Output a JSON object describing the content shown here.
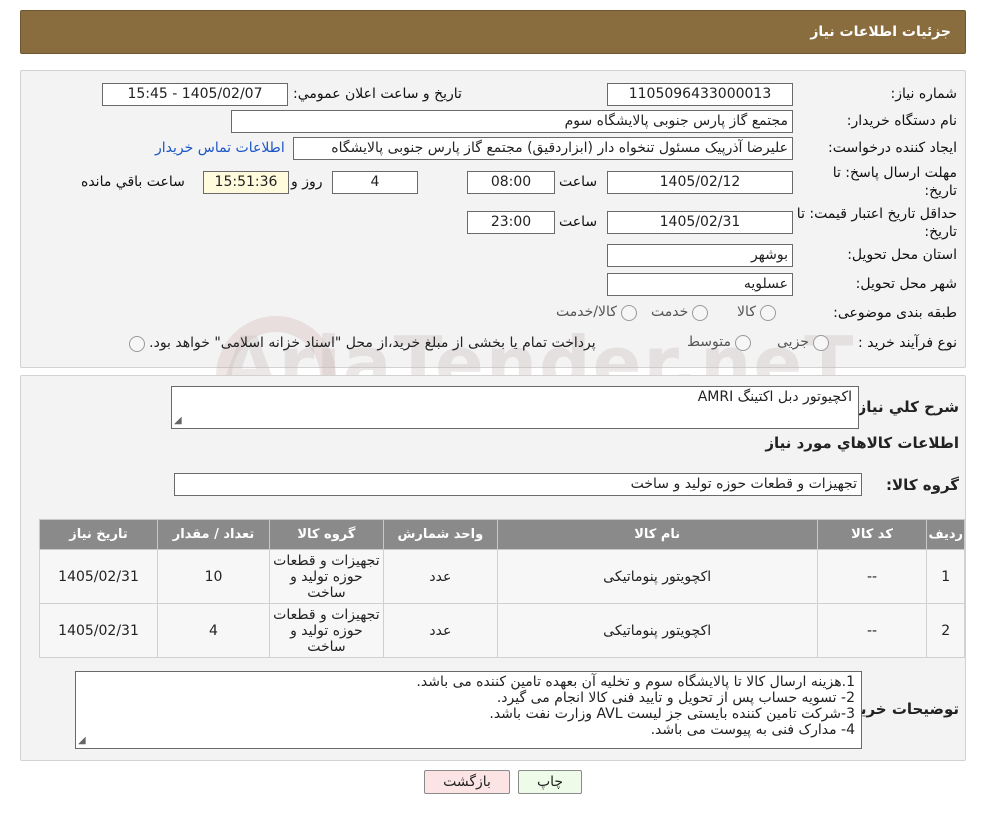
{
  "header": {
    "title": "جزئیات اطلاعات نیاز"
  },
  "details": {
    "need_number_label": "شماره نیاز:",
    "need_number": "1105096433000013",
    "announce_label": "تاریخ و ساعت اعلان عمومي:",
    "announce_value": "1405/02/07 - 15:45",
    "buyer_org_label": "نام دستگاه خريدار:",
    "buyer_org": "مجتمع گاز پارس جنوبی  پالایشگاه سوم",
    "requester_label": "ايجاد کننده درخواست:",
    "requester": "علیرضا آذرپیک مسئول تنخواه دار  (ابزاردقیق) مجتمع گاز پارس جنوبی  پالایشگاه",
    "contact_link": "اطلاعات تماس خريدار",
    "deadline_label_1": "مهلت ارسال پاسخ: تا",
    "deadline_label_2": "تاريخ:",
    "deadline_date": "1405/02/12",
    "time_label": "ساعت",
    "deadline_time": "08:00",
    "days_value": "4",
    "days_label": "روز و",
    "remaining_time": "15:51:36",
    "remaining_label": "ساعت باقي مانده",
    "validity_label_1": "حداقل تاريخ اعتبار قيمت: تا",
    "validity_label_2": "تاريخ:",
    "validity_date": "1405/02/31",
    "validity_time": "23:00",
    "province_label": "استان محل تحويل:",
    "province": "بوشهر",
    "city_label": "شهر محل تحويل:",
    "city": "عسلويه",
    "category_label": "طبقه بندی موضوعی:",
    "category_options": [
      "کالا",
      "خدمت",
      "کالا/خدمت"
    ],
    "purchase_type_label": "نوع فرآیند خرید :",
    "purchase_options": [
      "جزیی",
      "متوسط"
    ],
    "purchase_note": "پرداخت تمام یا بخشی از مبلغ خرید،از محل \"اسناد خزانه اسلامی\" خواهد بود."
  },
  "watermark": {
    "text": "AriaTender.neT"
  },
  "summary": {
    "label": "شرح کلي نياز:",
    "value": "اکچیوتور دبل اکتینگ AMRI",
    "goods_info_title": "اطلاعات کالاهاي مورد نياز",
    "group_label": "گروه کالا:",
    "group_value": "تجهیزات و قطعات حوزه تولید و ساخت"
  },
  "table": {
    "headers": [
      "رديف",
      "کد کالا",
      "نام کالا",
      "واحد شمارش",
      "گروه کالا",
      "تعداد / مقدار",
      "تاريخ نياز"
    ],
    "rows": [
      [
        "1",
        "--",
        "اکچویتور پنوماتیکی",
        "عدد",
        "تجهیزات و قطعات حوزه تولید و ساخت",
        "10",
        "1405/02/31"
      ],
      [
        "2",
        "--",
        "اکچویتور پنوماتیکی",
        "عدد",
        "تجهیزات و قطعات حوزه تولید و ساخت",
        "4",
        "1405/02/31"
      ]
    ]
  },
  "notes": {
    "label": "توضيحات خريدار:",
    "lines": [
      "1.هزینه ارسال کالا تا پالایشگاه سوم و تخلیه آن بعهده تامین کننده می باشد.",
      "2- تسویه حساب پس از تحویل و تایید فنی کالا انجام می گیرد.",
      "3-شرکت تامین کننده بایستی جز لیست AVL وزارت نفت باشد.",
      "4- مدارک فنی به پیوست می باشد."
    ]
  },
  "buttons": {
    "print": "چاپ",
    "back": "بازگشت"
  }
}
